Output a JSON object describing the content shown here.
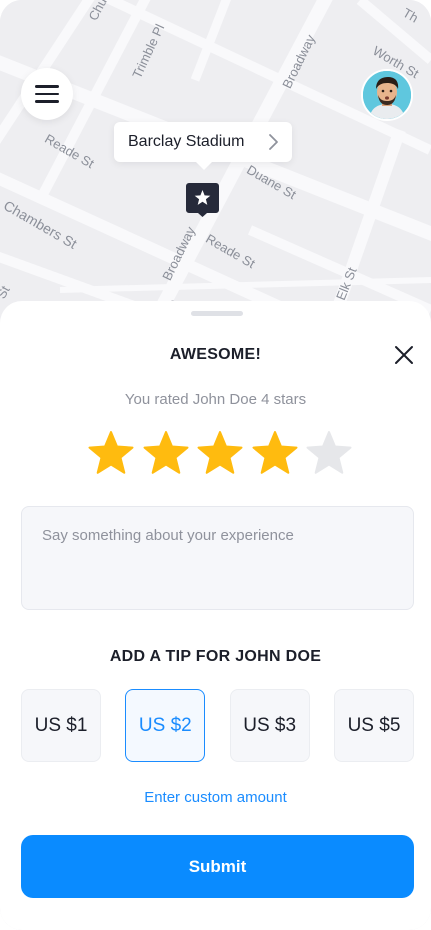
{
  "map": {
    "streets": [
      "Chu",
      "Trimble Pl",
      "Broadway",
      "Worth St",
      "Reade St",
      "Duane St",
      "Chambers St",
      "Broadway",
      "Reade St",
      "Elk St",
      "Ch",
      "St",
      "Th"
    ],
    "location_label": "Barclay Stadium"
  },
  "rating": {
    "title": "AWESOME!",
    "subtitle": "You rated John Doe 4 stars",
    "value": 4,
    "max": 5,
    "star_color": "#ffbb0f",
    "empty_star_color": "#e6e7ea",
    "feedback_placeholder": "Say something about your experience"
  },
  "tip": {
    "title": "ADD A TIP FOR JOHN DOE",
    "options": [
      "US $1",
      "US $2",
      "US $3",
      "US $5"
    ],
    "selected": "US $2",
    "custom_label": "Enter custom amount"
  },
  "submit_label": "Submit",
  "colors": {
    "accent": "#0a8bff",
    "text": "#1c1f2a",
    "muted": "#8f929c",
    "pin": "#262a3a"
  },
  "icons": {
    "menu": "hamburger-icon",
    "close": "close-icon",
    "pin": "star-map-pin-icon",
    "chevron": "chevron-right-icon"
  }
}
